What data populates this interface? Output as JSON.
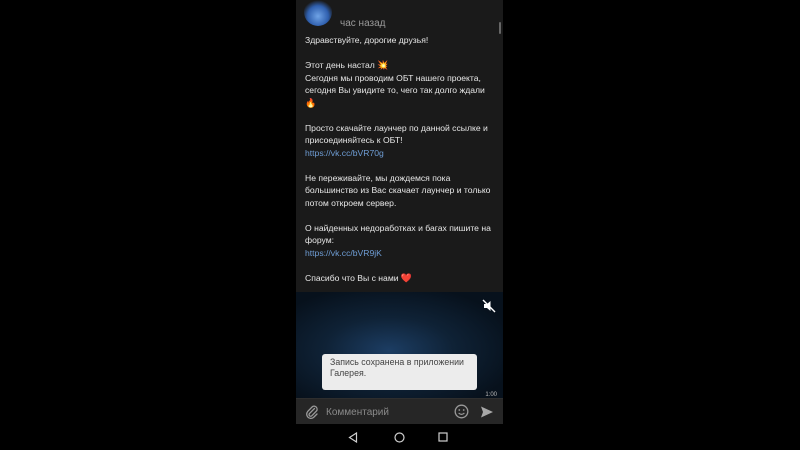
{
  "post": {
    "time_ago": "час назад",
    "greeting": "Здравствуйте, дорогие друзья!",
    "day_line": "Этот день настал",
    "day_emoji": "💥",
    "obt_text": "Сегодня мы проводим ОБТ нашего проекта, сегодня Вы увидите то, чего так долго ждали",
    "fire_emoji": "🔥",
    "download_text": "Просто скачайте лаунчер по данной ссылке и присоединяйтесь к ОБТ!",
    "download_link": "https://vk.cc/bVR70g",
    "wait_text": "Не переживайте, мы дождемся пока большинство из Вас скачает лаунчер и только потом откроем сервер.",
    "bugs_text": "О найденных недоработках и багах пишите на форум:",
    "forum_link": "https://vk.cc/bVR9jK",
    "thanks_text": "Спасибо что Вы с нами",
    "heart_emoji": "❤️"
  },
  "video": {
    "toast": "Запись сохранена в приложении Галерея.",
    "time": "1:00"
  },
  "comment": {
    "placeholder": "Комментарий"
  },
  "icons": {
    "mute": "speaker-off-icon",
    "attach": "paperclip-icon",
    "emoji": "smile-icon",
    "send": "send-icon",
    "nav": [
      "back-icon",
      "home-icon",
      "recent-apps-icon"
    ]
  },
  "colors": {
    "background": "#1a1a1a",
    "text": "#e8e8e8",
    "link": "#6f9ed6",
    "toast_bg": "#ececec"
  }
}
